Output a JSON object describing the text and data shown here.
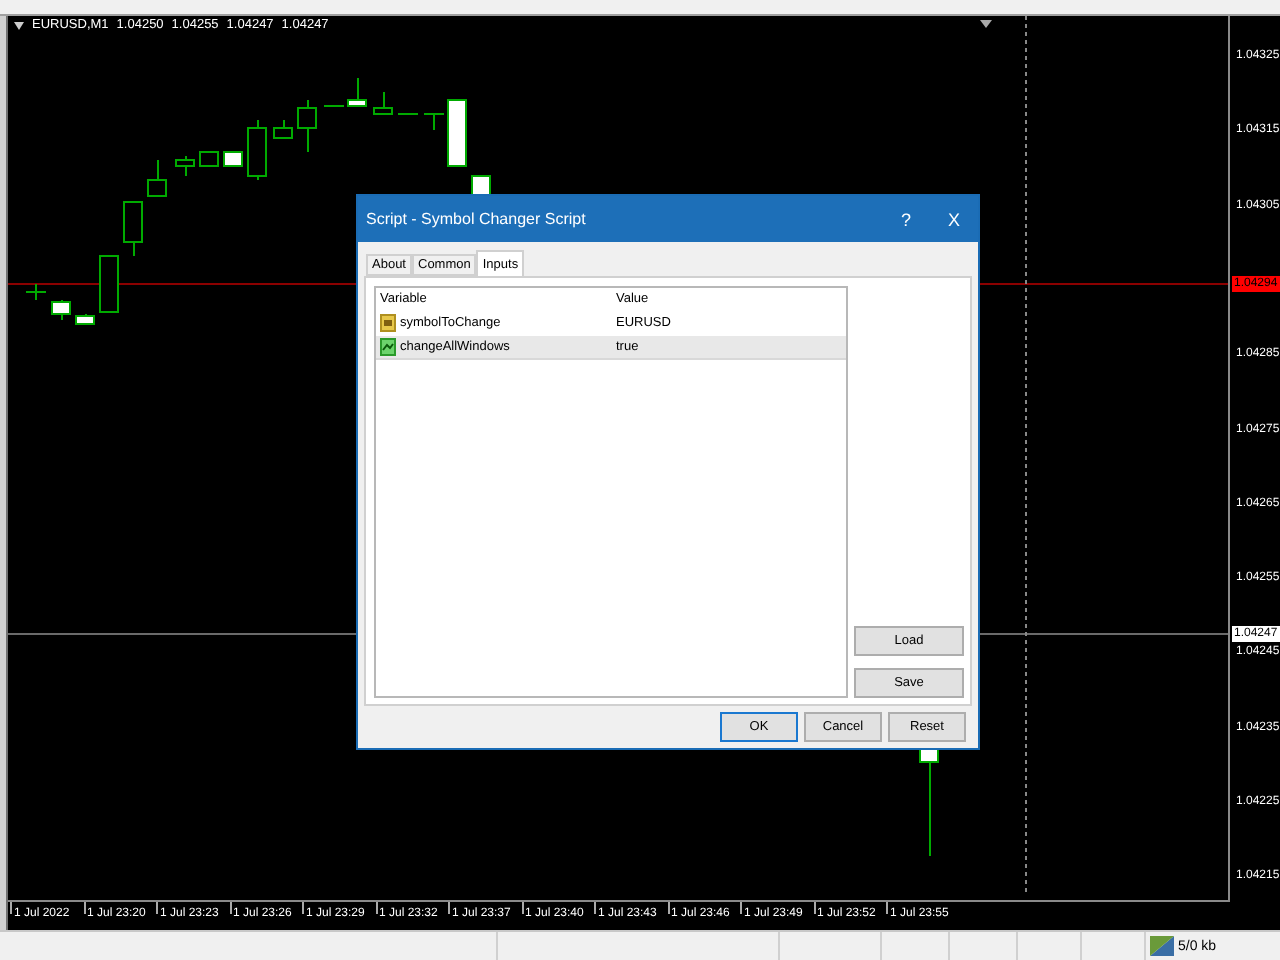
{
  "chart": {
    "symbol": "EURUSD,M1",
    "ohlc": [
      "1.04250",
      "1.04255",
      "1.04247",
      "1.04247"
    ]
  },
  "price_axis": {
    "ticks_upper": [
      "1.04325",
      "1.04315",
      "1.04305"
    ],
    "ticks_lower": [
      "1.04285",
      "1.04275",
      "1.04265",
      "1.04255",
      "1.04245",
      "1.04235",
      "1.04225",
      "1.04215"
    ],
    "markers": [
      {
        "label": "1.04294",
        "kind": "bid"
      },
      {
        "label": "1.04247",
        "kind": "crosshair"
      }
    ]
  },
  "time_axis": [
    "1 Jul 2022",
    "1 Jul 23:20",
    "1 Jul 23:23",
    "1 Jul 23:26",
    "1 Jul 23:29",
    "1 Jul 23:32",
    "1 Jul 23:37",
    "1 Jul 23:40",
    "1 Jul 23:43",
    "1 Jul 23:46",
    "1 Jul 23:49",
    "1 Jul 23:52",
    "1 Jul 23:55"
  ],
  "dialog": {
    "title": "Script - Symbol Changer Script",
    "help": "?",
    "close": "X",
    "tabs": [
      {
        "label": "About",
        "selected": false
      },
      {
        "label": "Common",
        "selected": false
      },
      {
        "label": "Inputs",
        "selected": true
      }
    ],
    "table": {
      "columns": [
        "Variable",
        "Value"
      ],
      "rows": [
        {
          "kind": "string",
          "variable": "symbolToChange",
          "value": "EURUSD",
          "selected": false
        },
        {
          "kind": "bool",
          "variable": "changeAllWindows",
          "value": "true",
          "selected": true
        }
      ]
    },
    "side_buttons": [
      "Load",
      "Save"
    ],
    "buttons": [
      {
        "label": "OK",
        "default": true
      },
      {
        "label": "Cancel",
        "default": false
      },
      {
        "label": "Reset",
        "default": false
      }
    ]
  },
  "status_bar": {
    "traffic": "5/0 kb"
  }
}
